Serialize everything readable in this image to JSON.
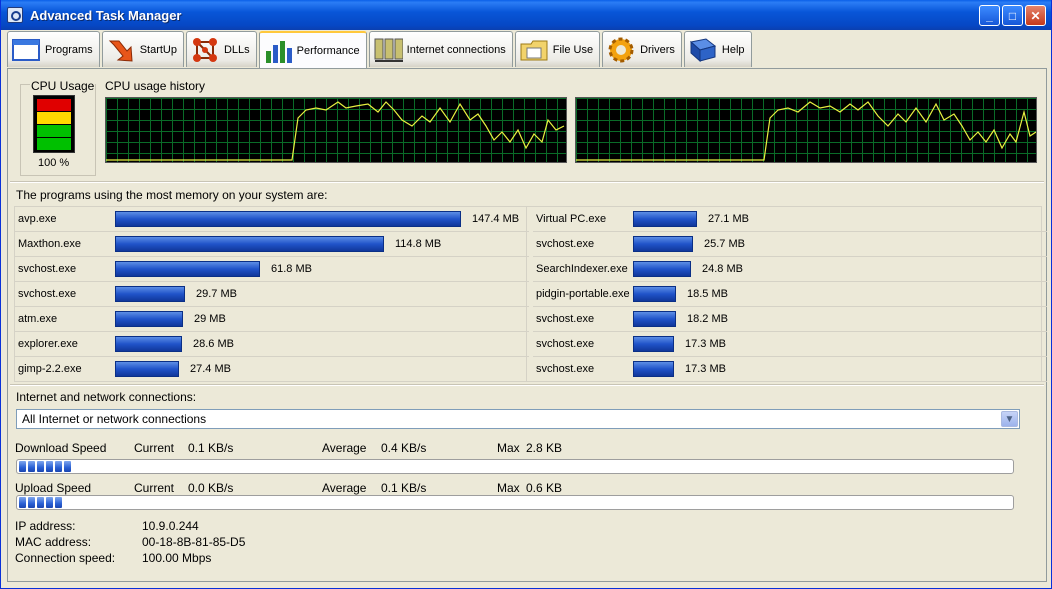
{
  "window": {
    "title": "Advanced Task Manager",
    "minimize": "_",
    "maximize": "□",
    "close": "✕"
  },
  "tabs": [
    {
      "label": "Programs",
      "icon": "programs-window-icon"
    },
    {
      "label": "StartUp",
      "icon": "startup-arrow-icon"
    },
    {
      "label": "DLLs",
      "icon": "dlls-molecule-icon"
    },
    {
      "label": "Performance",
      "icon": "performance-chart-icon",
      "active": true
    },
    {
      "label": "Internet connections",
      "icon": "internet-connections-icon"
    },
    {
      "label": "File Use",
      "icon": "file-use-folder-icon"
    },
    {
      "label": "Drivers",
      "icon": "drivers-gear-icon"
    },
    {
      "label": "Help",
      "icon": "help-book-icon"
    }
  ],
  "cpu": {
    "label": "CPU Usage",
    "percent_text": "100 %",
    "history_label": "CPU usage history",
    "usage_fraction": 1.0
  },
  "memory": {
    "title": "The programs using the most memory on your system are:",
    "max_mb": 147.4,
    "left": [
      {
        "name": "avp.exe",
        "mb": 147.4,
        "size": "147.4 MB"
      },
      {
        "name": "Maxthon.exe",
        "mb": 114.8,
        "size": "114.8 MB"
      },
      {
        "name": "svchost.exe",
        "mb": 61.8,
        "size": "61.8 MB"
      },
      {
        "name": "svchost.exe",
        "mb": 29.7,
        "size": "29.7 MB"
      },
      {
        "name": "atm.exe",
        "mb": 29,
        "size": "29 MB"
      },
      {
        "name": "explorer.exe",
        "mb": 28.6,
        "size": "28.6 MB"
      },
      {
        "name": "gimp-2.2.exe",
        "mb": 27.4,
        "size": "27.4 MB"
      }
    ],
    "right": [
      {
        "name": "Virtual PC.exe",
        "mb": 27.1,
        "size": "27.1 MB"
      },
      {
        "name": "svchost.exe",
        "mb": 25.7,
        "size": "25.7 MB"
      },
      {
        "name": "SearchIndexer.exe",
        "mb": 24.8,
        "size": "24.8 MB"
      },
      {
        "name": "pidgin-portable.exe",
        "mb": 18.5,
        "size": "18.5 MB"
      },
      {
        "name": "svchost.exe",
        "mb": 18.2,
        "size": "18.2 MB"
      },
      {
        "name": "svchost.exe",
        "mb": 17.3,
        "size": "17.3 MB"
      },
      {
        "name": "svchost.exe",
        "mb": 17.3,
        "size": "17.3 MB"
      }
    ]
  },
  "network": {
    "title": "Internet and network connections:",
    "selected": "All Internet or network connections",
    "download": {
      "label": "Download Speed",
      "current_label": "Current",
      "current": "0.1 KB/s",
      "average_label": "Average",
      "average": "0.4 KB/s",
      "max_label": "Max",
      "max": "2.8 KB",
      "fill_segments": 6
    },
    "upload": {
      "label": "Upload Speed",
      "current_label": "Current",
      "current": "0.0 KB/s",
      "average_label": "Average",
      "average": "0.1 KB/s",
      "max_label": "Max",
      "max": "0.6 KB",
      "fill_segments": 5
    },
    "ip_label": "IP address:",
    "ip": "10.9.0.244",
    "mac_label": "MAC address:",
    "mac": "00-18-8B-81-85-D5",
    "speed_label": "Connection speed:",
    "speed": "100.00 Mbps"
  },
  "colors": {
    "graph_line": "#e8f040",
    "graph_grid": "#0a6b28",
    "meter_red": "#e00000",
    "meter_yellow": "#ffd800",
    "meter_green": "#00c000"
  }
}
